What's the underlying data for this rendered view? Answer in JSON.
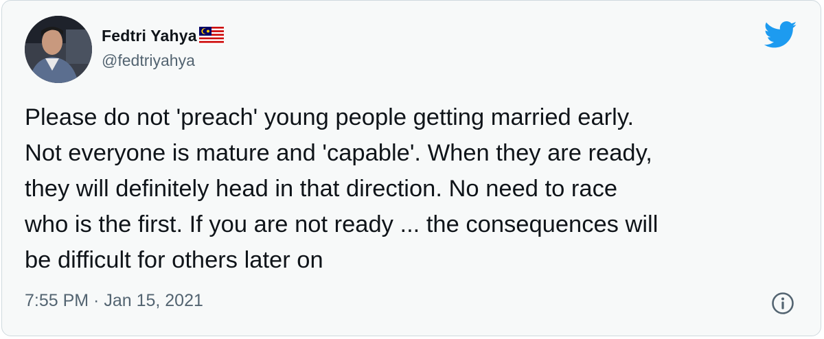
{
  "tweet": {
    "display_name": "Fedtri Yahya",
    "handle": "@fedtriyahya",
    "text": "Please do not 'preach' young people getting married early.\nNot everyone is mature and 'capable'. When they are ready,\nthey will definitely head in that direction. No need to race\nwho is the first. If you are not ready ... the consequences will\nbe difficult for others later on",
    "timestamp": "7:55 PM · Jan 15, 2021"
  },
  "icons": {
    "avatar": "profile-photo",
    "flag": "malaysia-flag-icon",
    "brand": "twitter-bird-icon",
    "info": "info-icon"
  },
  "colors": {
    "twitter_blue": "#1d9bf0",
    "secondary_text": "#536471",
    "card_background": "#f7f9f9"
  }
}
